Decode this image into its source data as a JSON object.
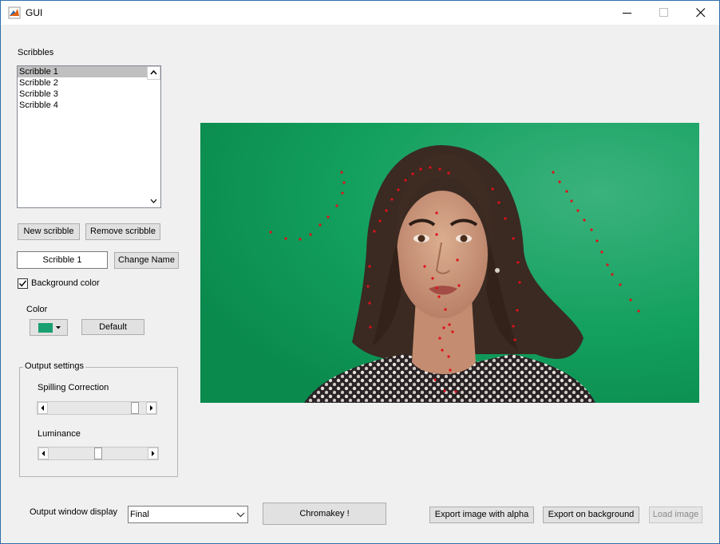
{
  "window": {
    "title": "GUI",
    "controls": {
      "minimize": "minimize-icon",
      "maximize": "maximize-icon",
      "close": "close-icon"
    }
  },
  "scribbles": {
    "label": "Scribbles",
    "items": [
      "Scribble 1",
      "Scribble 2",
      "Scribble 3",
      "Scribble 4"
    ],
    "selected_index": 0,
    "new_button": "New scribble",
    "remove_button": "Remove scribble",
    "name_value": "Scribble 1",
    "change_name_button": "Change Name",
    "background_checkbox": {
      "label": "Background color",
      "checked": true
    }
  },
  "color": {
    "label": "Color",
    "swatch_color": "#1aa070",
    "default_button": "Default"
  },
  "output_settings": {
    "title": "Output settings",
    "spilling": {
      "label": "Spilling Correction",
      "value": 0.92
    },
    "luminance": {
      "label": "Luminance",
      "value": 0.5
    }
  },
  "bottom": {
    "output_window_label": "Output window display",
    "output_window_value": "Final",
    "chromakey_button": "Chromakey !",
    "export_alpha_button": "Export image with alpha",
    "export_background_button": "Export on background",
    "load_image_button": "Load image"
  },
  "colors": {
    "title_accent": "#2f6da8",
    "scribble_dot": "#e0101a",
    "green_screen": "#0f9a5b"
  }
}
